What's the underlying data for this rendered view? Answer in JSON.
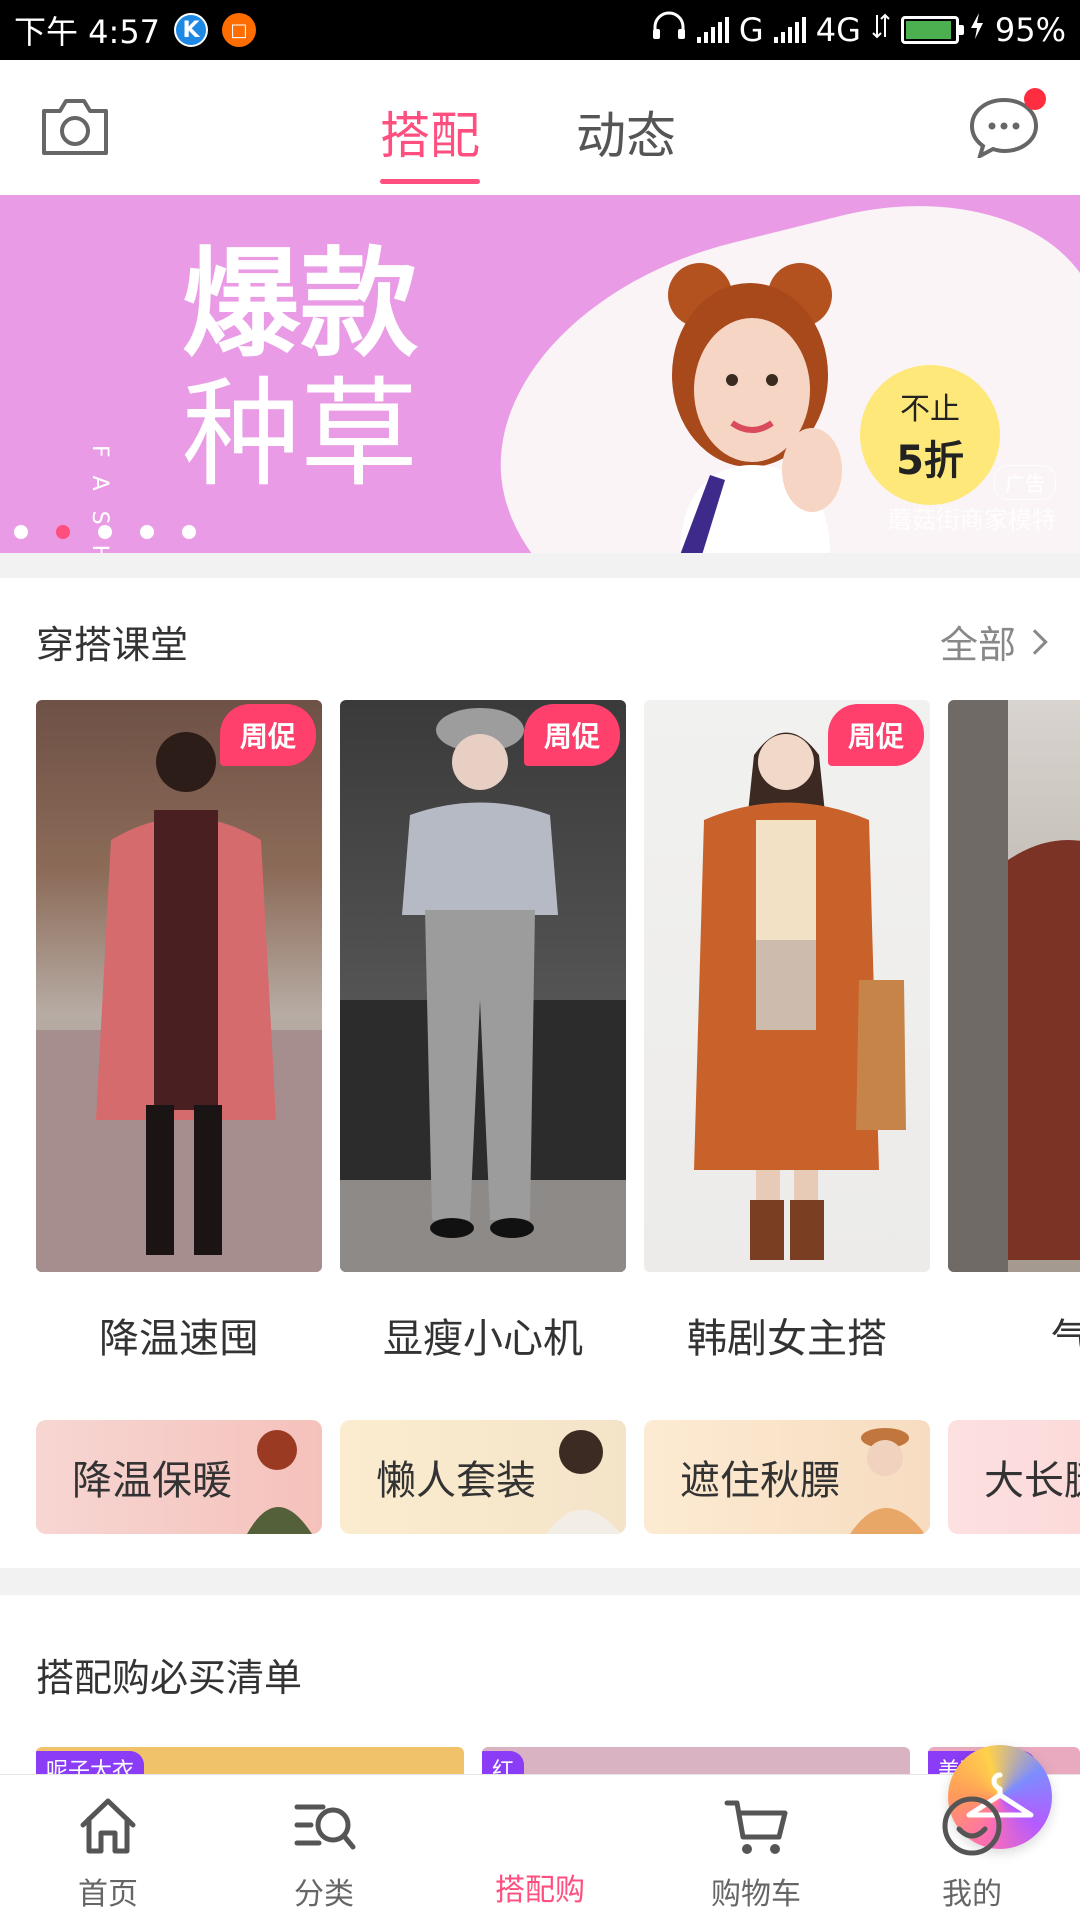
{
  "status_bar": {
    "time": "下午 4:57",
    "network": "G",
    "network2": "4G",
    "battery": "95%",
    "battery_level": 0.95
  },
  "header": {
    "tabs": [
      {
        "label": "搭配",
        "active": true
      },
      {
        "label": "动态",
        "active": false
      }
    ],
    "has_notification_dot": true
  },
  "banner": {
    "vertical_text": "FASHION",
    "headline_1": "爆款",
    "headline_2": "种草",
    "sale_line1": "不止",
    "sale_line2": "5折",
    "ad_label": "广告",
    "credit": "蘑菇街商家模特",
    "dots_count": 5,
    "active_dot": 1,
    "background_color": "#e99be6"
  },
  "section_outfit": {
    "title": "穿搭课堂",
    "see_all": "全部",
    "cards": [
      {
        "label": "降温速囤",
        "tag": "周促"
      },
      {
        "label": "显瘦小心机",
        "tag": "周促"
      },
      {
        "label": "韩剧女主搭",
        "tag": "周促"
      },
      {
        "label": "气质",
        "tag": ""
      }
    ],
    "chips": [
      {
        "label": "降温保暖"
      },
      {
        "label": "懒人套装"
      },
      {
        "label": "遮住秋膘"
      },
      {
        "label": "大长腿"
      }
    ]
  },
  "section_list": {
    "title": "搭配购必买清单",
    "mini_tags": [
      "呢子大衣",
      "红",
      "美丽优选"
    ]
  },
  "bottom_nav": {
    "items": [
      {
        "label": "首页",
        "icon": "home-icon"
      },
      {
        "label": "分类",
        "icon": "category-search-icon"
      },
      {
        "label": "搭配购",
        "icon": "hanger-icon",
        "active": true
      },
      {
        "label": "购物车",
        "icon": "cart-icon"
      },
      {
        "label": "我的",
        "icon": "profile-icon"
      }
    ]
  },
  "colors": {
    "accent": "#ff4f7e",
    "promo_tag": "#ff3f6c",
    "mini_tag": "#8b3cf6"
  }
}
